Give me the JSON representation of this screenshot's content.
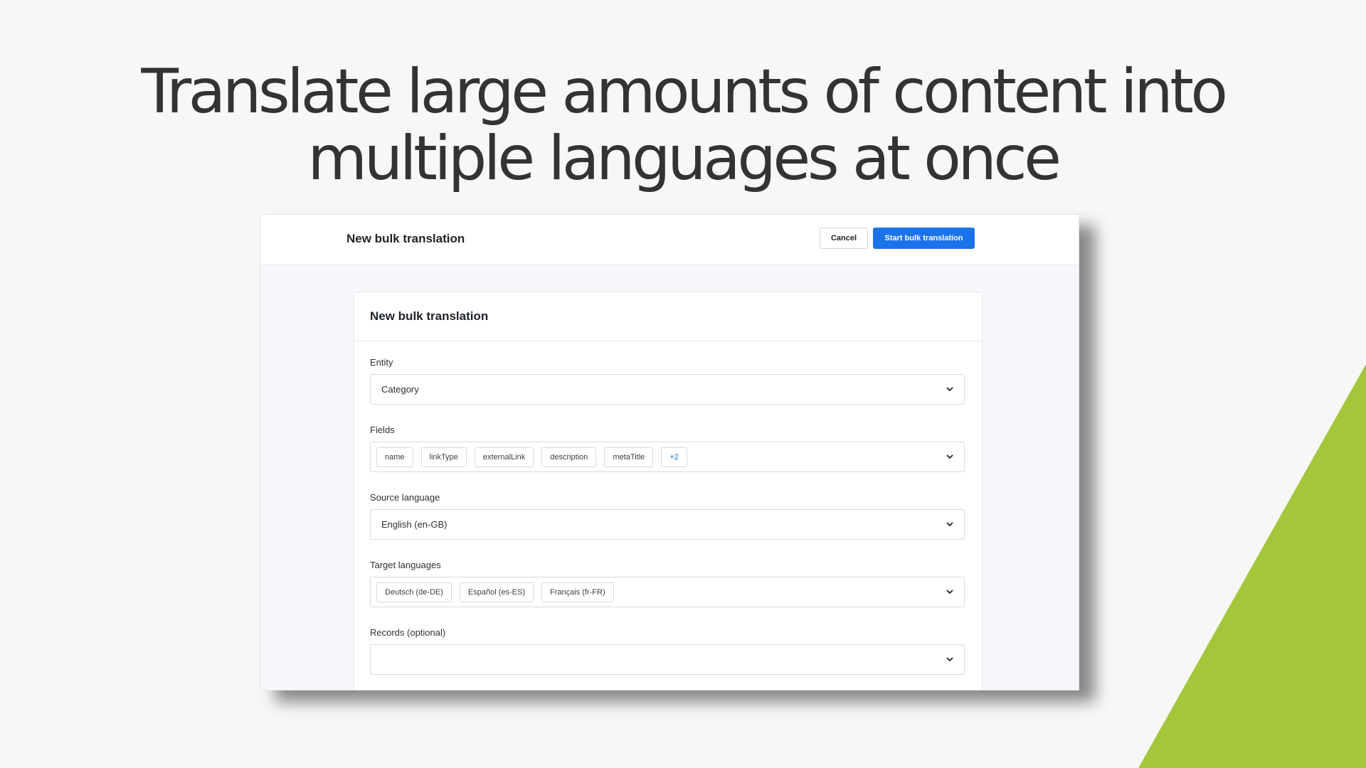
{
  "headline": {
    "line1": "Translate large amounts of content into",
    "line2": "multiple languages at once"
  },
  "colors": {
    "accent_green": "#a5c63b",
    "primary_blue": "#1a73e8",
    "background": "#f7f7f7"
  },
  "app": {
    "topbar_title": "New bulk translation",
    "cancel_label": "Cancel",
    "start_label": "Start bulk translation"
  },
  "form": {
    "title": "New bulk translation",
    "entity": {
      "label": "Entity",
      "value": "Category"
    },
    "fields": {
      "label": "Fields",
      "chips": [
        "name",
        "linkType",
        "externalLink",
        "description",
        "metaTitle"
      ],
      "more": "+2"
    },
    "source_language": {
      "label": "Source language",
      "value": "English (en-GB)"
    },
    "target_languages": {
      "label": "Target languages",
      "chips": [
        "Deutsch (de-DE)",
        "Español (es-ES)",
        "Français (fr-FR)"
      ]
    },
    "records": {
      "label": "Records (optional)",
      "value": ""
    }
  },
  "icons": {
    "dropdown": "chevron-down-icon"
  }
}
